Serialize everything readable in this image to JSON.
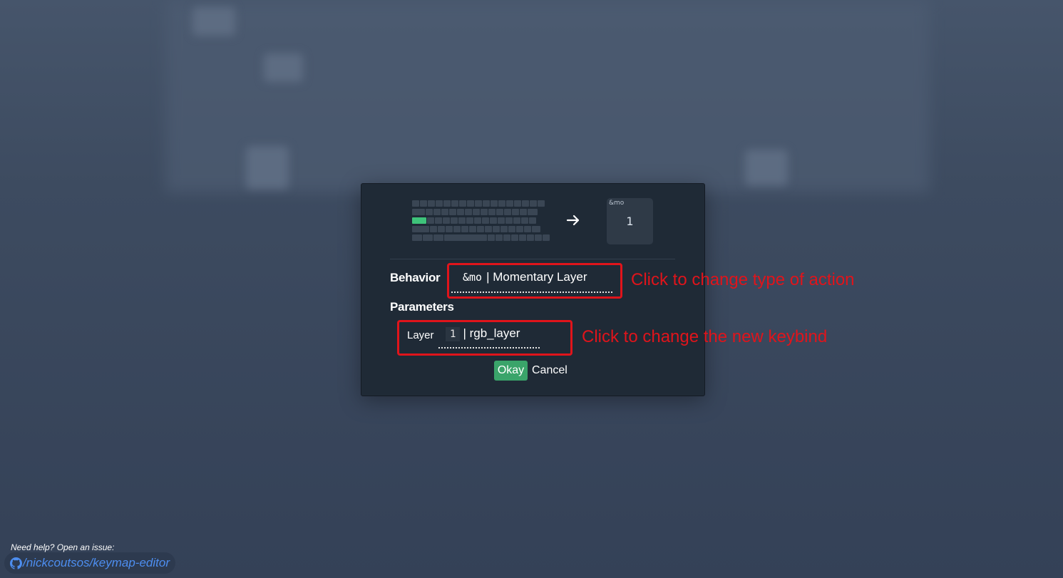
{
  "modal": {
    "key_preview": {
      "behavior_code": "&mo",
      "param_value": "1"
    },
    "behavior": {
      "label": "Behavior",
      "code": "&mo",
      "name": "| Momentary Layer"
    },
    "parameters": {
      "label": "Parameters",
      "layer_label": "Layer",
      "layer_code": "1",
      "layer_name": "| rgb_layer"
    },
    "buttons": {
      "okay": "Okay",
      "cancel": "Cancel"
    }
  },
  "annotations": {
    "behavior_hint": "Click to change type of action",
    "parameter_hint": "Click to change the new keybind",
    "color": "#e0141b"
  },
  "footer": {
    "help_text": "Need help? Open an issue:",
    "repo_link": "/nickcoutsos/keymap-editor",
    "icon": "github-icon"
  },
  "colors": {
    "active_key": "#3ec37a",
    "okay_button": "#3aa46a",
    "link": "#4d8ef0"
  }
}
